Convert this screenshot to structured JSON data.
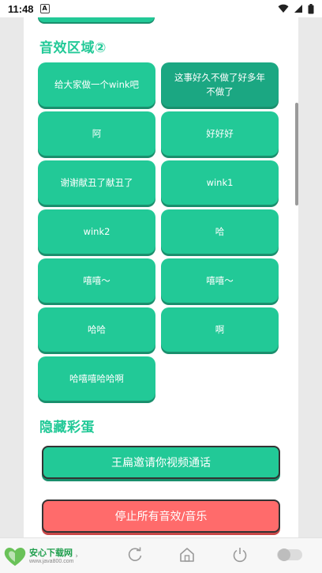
{
  "status_bar": {
    "time": "11:48",
    "badge": "A"
  },
  "section_sound": {
    "title": "音效区域②"
  },
  "buttons": [
    {
      "label": "给大家做一个wink吧"
    },
    {
      "label": "这事好久不做了好多年不做了"
    },
    {
      "label": "阿"
    },
    {
      "label": "好好好"
    },
    {
      "label": "谢谢献丑了献丑了"
    },
    {
      "label": "wink1"
    },
    {
      "label": "wink2"
    },
    {
      "label": "哈"
    },
    {
      "label": "嘻嘻～"
    },
    {
      "label": "嘻嘻～"
    },
    {
      "label": "哈哈"
    },
    {
      "label": "啊"
    },
    {
      "label": "哈嘻嘻哈哈啊"
    }
  ],
  "section_easter": {
    "title": "隐藏彩蛋"
  },
  "actions": {
    "video_call": "王扁邀请你视频通话",
    "stop_all": "停止所有音效/音乐"
  },
  "watermark": {
    "name": "安心下载网",
    "url": "www.java800.com"
  },
  "colors": {
    "accent": "#22c997",
    "stop": "#ff6b6b"
  },
  "nav_icons": [
    "refresh-icon",
    "home-icon",
    "power-icon",
    "toggle-icon"
  ]
}
